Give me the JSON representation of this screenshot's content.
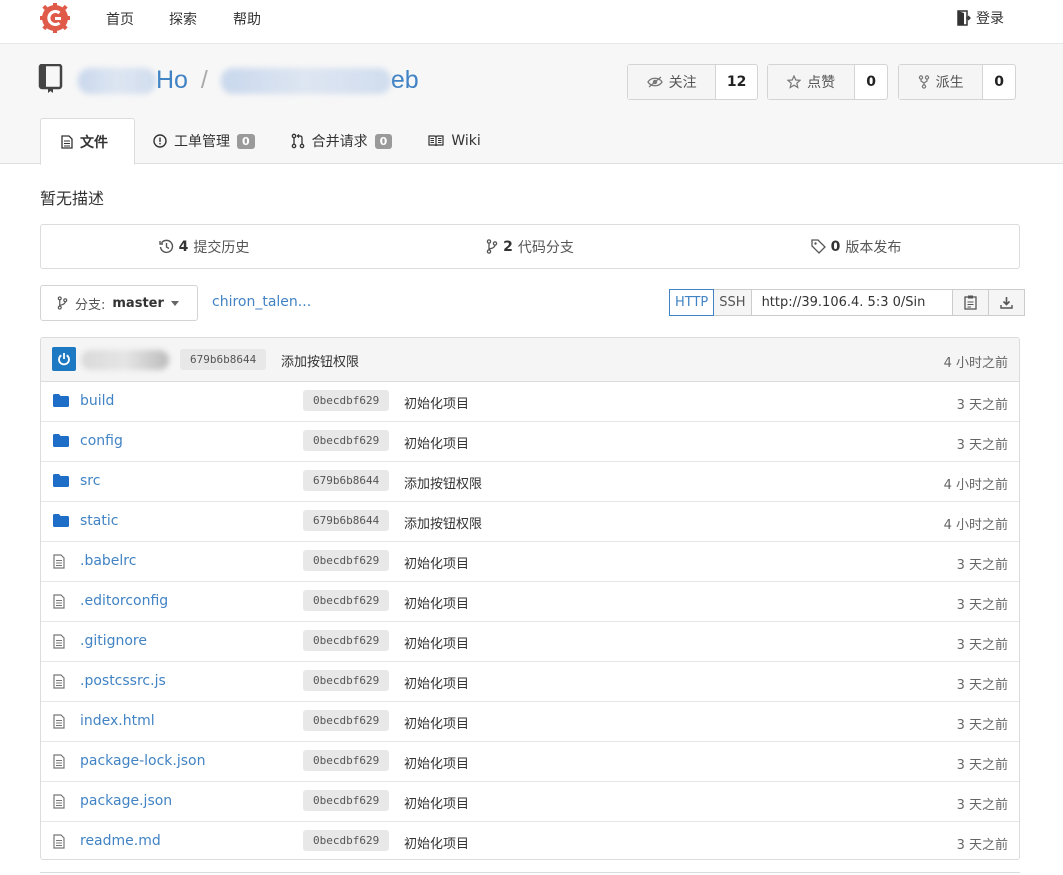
{
  "nav": {
    "logo_icon": "gitea-logo-icon",
    "links": [
      "首页",
      "探索",
      "帮助"
    ],
    "login": "登录"
  },
  "repo": {
    "owner_visible": "Ho",
    "name_visible": "eb",
    "separator": "/",
    "watch": {
      "label": "关注",
      "count": "12"
    },
    "star": {
      "label": "点赞",
      "count": "0"
    },
    "fork": {
      "label": "派生",
      "count": "0"
    }
  },
  "tabs": [
    {
      "label": "文件",
      "active": true
    },
    {
      "label": "工单管理",
      "badge": "0"
    },
    {
      "label": "合并请求",
      "badge": "0"
    },
    {
      "label": "Wiki"
    }
  ],
  "description": "暂无描述",
  "summary": {
    "commits": {
      "count": "4",
      "label": "提交历史"
    },
    "branches": {
      "count": "2",
      "label": "代码分支"
    },
    "releases": {
      "count": "0",
      "label": "版本发布"
    }
  },
  "branch": {
    "prefix": "分支:",
    "name": "master"
  },
  "breadcrumb": "chiron_talen...",
  "clone": {
    "http_label": "HTTP",
    "ssh_label": "SSH",
    "url": "http://39.106.4.  5:3  0/Sin"
  },
  "latest_commit": {
    "sha": "679b6b8644",
    "message": "添加按钮权限",
    "time": "4 小时之前"
  },
  "files": [
    {
      "type": "folder",
      "name": "build",
      "sha": "0becdbf629",
      "message": "初始化项目",
      "time": "3 天之前"
    },
    {
      "type": "folder",
      "name": "config",
      "sha": "0becdbf629",
      "message": "初始化项目",
      "time": "3 天之前"
    },
    {
      "type": "folder",
      "name": "src",
      "sha": "679b6b8644",
      "message": "添加按钮权限",
      "time": "4 小时之前"
    },
    {
      "type": "folder",
      "name": "static",
      "sha": "679b6b8644",
      "message": "添加按钮权限",
      "time": "4 小时之前"
    },
    {
      "type": "file",
      "name": ".babelrc",
      "sha": "0becdbf629",
      "message": "初始化项目",
      "time": "3 天之前"
    },
    {
      "type": "file",
      "name": ".editorconfig",
      "sha": "0becdbf629",
      "message": "初始化项目",
      "time": "3 天之前"
    },
    {
      "type": "file",
      "name": ".gitignore",
      "sha": "0becdbf629",
      "message": "初始化项目",
      "time": "3 天之前"
    },
    {
      "type": "file",
      "name": ".postcssrc.js",
      "sha": "0becdbf629",
      "message": "初始化项目",
      "time": "3 天之前"
    },
    {
      "type": "file",
      "name": "index.html",
      "sha": "0becdbf629",
      "message": "初始化项目",
      "time": "3 天之前"
    },
    {
      "type": "file",
      "name": "package-lock.json",
      "sha": "0becdbf629",
      "message": "初始化项目",
      "time": "3 天之前"
    },
    {
      "type": "file",
      "name": "package.json",
      "sha": "0becdbf629",
      "message": "初始化项目",
      "time": "3 天之前"
    },
    {
      "type": "file",
      "name": "readme.md",
      "sha": "0becdbf629",
      "message": "初始化项目",
      "time": "3 天之前"
    }
  ],
  "colors": {
    "link": "#4183c4",
    "logo": "#e05a4a",
    "folder": "#1e6ec8",
    "avatar": "#1e79c3",
    "badge": "#9a9a9a"
  }
}
